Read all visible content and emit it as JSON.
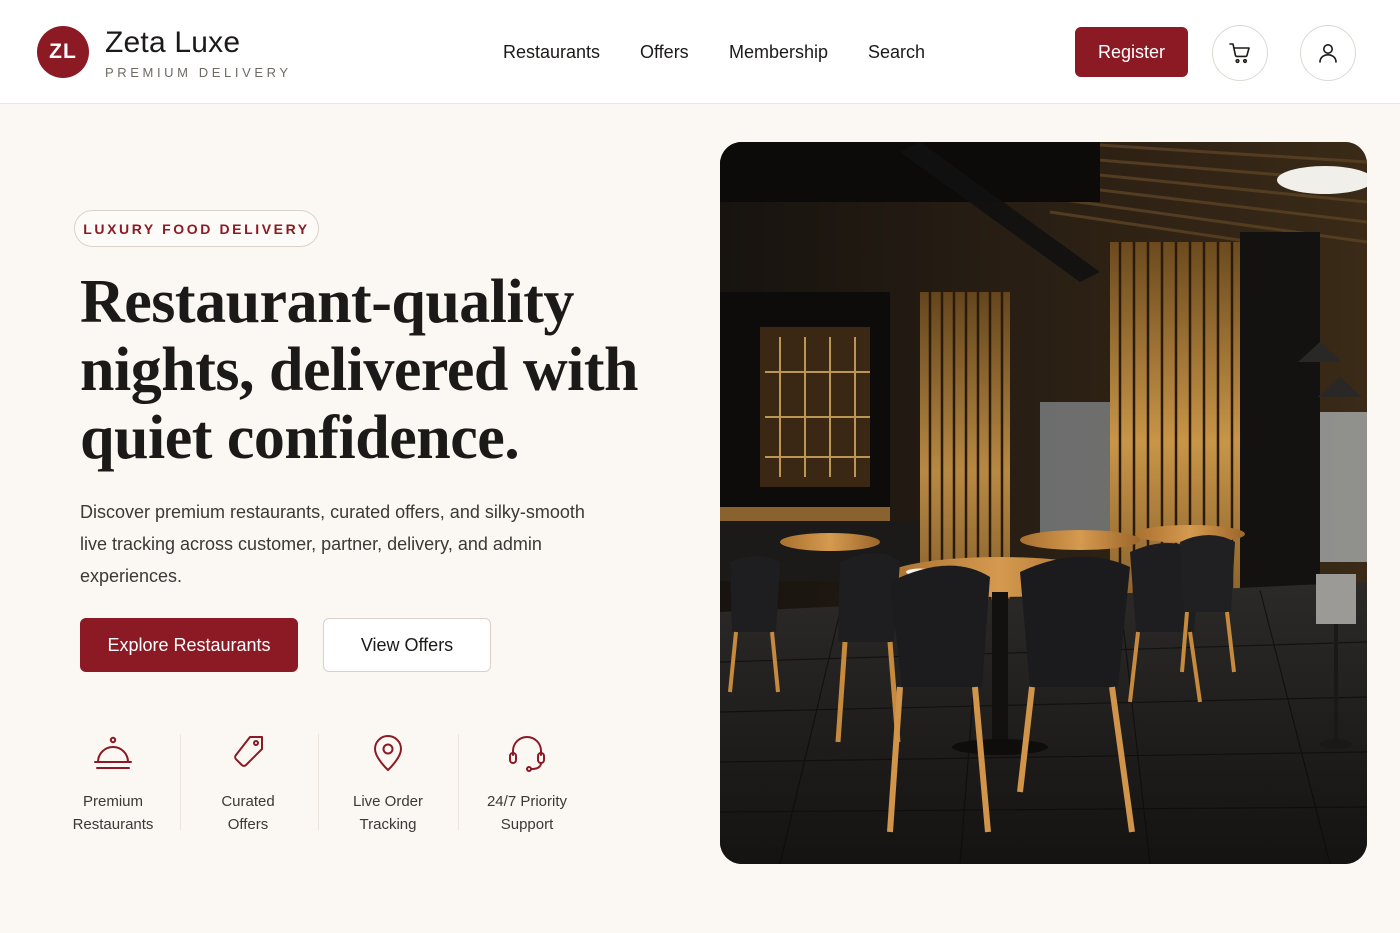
{
  "brand": {
    "badge": "ZL",
    "name": "Zeta Luxe",
    "tagline": "PREMIUM DELIVERY"
  },
  "nav": [
    "Restaurants",
    "Offers",
    "Membership",
    "Search"
  ],
  "header_actions": {
    "register": "Register",
    "cart_icon": "cart-icon",
    "user_icon": "user-icon"
  },
  "hero": {
    "tag": "LUXURY FOOD DELIVERY",
    "title": "Restaurant-quality nights, delivered with quiet confidence.",
    "description": "Discover premium restaurants, curated offers, and silky-smooth live tracking across customer, partner, delivery, and admin experiences.",
    "primary_cta": "Explore Restaurants",
    "secondary_cta": "View Offers"
  },
  "features": [
    {
      "icon": "cloche-icon",
      "label": "Premium\nRestaurants"
    },
    {
      "icon": "tag-icon",
      "label": "Curated\nOffers"
    },
    {
      "icon": "location-pin-icon",
      "label": "Live Order\nTracking"
    },
    {
      "icon": "headset-icon",
      "label": "24/7 Priority\nSupport"
    }
  ],
  "colors": {
    "accent": "#8b1a24",
    "background": "#fbf8f3",
    "text": "#1c1a19"
  }
}
